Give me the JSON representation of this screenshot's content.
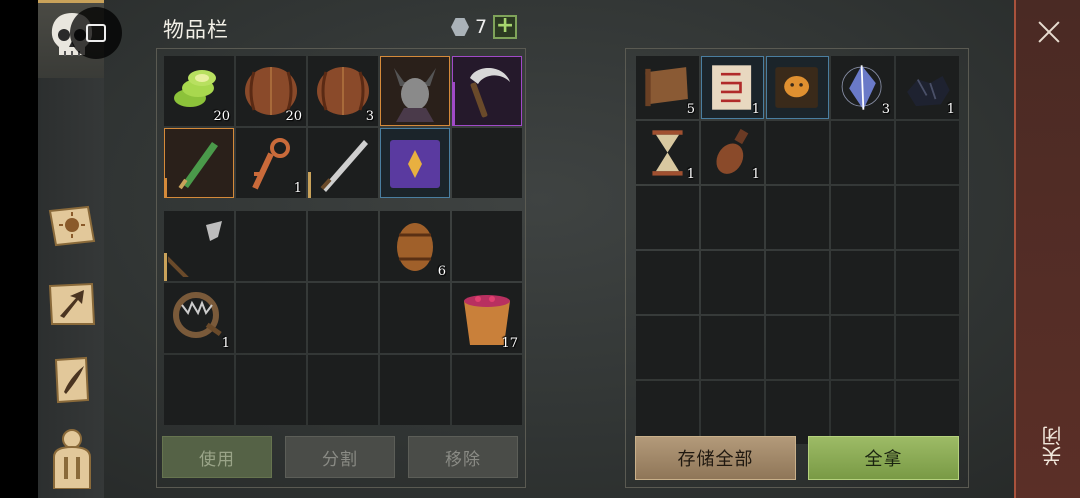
{
  "inventory": {
    "title": "物品栏",
    "currency": {
      "value": "7",
      "icon": "silver-gem-icon"
    },
    "actions": {
      "use": "使用",
      "split": "分割",
      "remove": "移除"
    },
    "equipped": [
      {
        "name": "green-vegetable-slices",
        "qty": "20",
        "tier": "common"
      },
      {
        "name": "wooden-barrel",
        "qty": "20",
        "tier": "common"
      },
      {
        "name": "wooden-barrel",
        "qty": "3",
        "tier": "common"
      },
      {
        "name": "horned-helmet-mannequin",
        "qty": "",
        "tier": "rare"
      },
      {
        "name": "sickle",
        "qty": "",
        "tier": "epic"
      },
      {
        "name": "green-dagger",
        "qty": "",
        "tier": "rare"
      },
      {
        "name": "bronze-key",
        "qty": "1",
        "tier": "common"
      },
      {
        "name": "long-sword",
        "qty": "",
        "tier": "common"
      },
      {
        "name": "purple-tome",
        "qty": "",
        "tier": "blue"
      },
      {
        "name": "empty",
        "qty": "",
        "tier": "common"
      }
    ],
    "backpack": [
      {
        "name": "halberd",
        "qty": ""
      },
      {
        "name": "empty",
        "qty": ""
      },
      {
        "name": "empty",
        "qty": ""
      },
      {
        "name": "small-barrel",
        "qty": "6"
      },
      {
        "name": "empty",
        "qty": ""
      },
      {
        "name": "bear-trap",
        "qty": "1"
      },
      {
        "name": "empty",
        "qty": ""
      },
      {
        "name": "empty",
        "qty": ""
      },
      {
        "name": "empty",
        "qty": ""
      },
      {
        "name": "berry-bucket",
        "qty": "17"
      },
      {
        "name": "empty",
        "qty": ""
      },
      {
        "name": "empty",
        "qty": ""
      },
      {
        "name": "empty",
        "qty": ""
      },
      {
        "name": "empty",
        "qty": ""
      },
      {
        "name": "empty",
        "qty": ""
      }
    ]
  },
  "storage": {
    "items": [
      {
        "name": "leather-scroll",
        "qty": "5"
      },
      {
        "name": "red-rune-scroll",
        "qty": "1"
      },
      {
        "name": "mask-book",
        "qty": ""
      },
      {
        "name": "crystal-shard",
        "qty": "3"
      },
      {
        "name": "coal",
        "qty": "1"
      },
      {
        "name": "hourglass",
        "qty": "1"
      },
      {
        "name": "clay-bottle",
        "qty": "1"
      }
    ],
    "actions": {
      "store_all": "存储全部",
      "take_all": "全拿"
    }
  },
  "sidebar": {
    "icons": [
      "skull-icon",
      "sun-book-icon",
      "map-arrow-icon",
      "quill-scroll-icon",
      "character-icon"
    ]
  },
  "close": {
    "label": "关闭"
  },
  "colors": {
    "rare": "#d58a3a",
    "epic": "#a04ac8",
    "blue": "#4a7ea0",
    "take": "#8aab55"
  }
}
